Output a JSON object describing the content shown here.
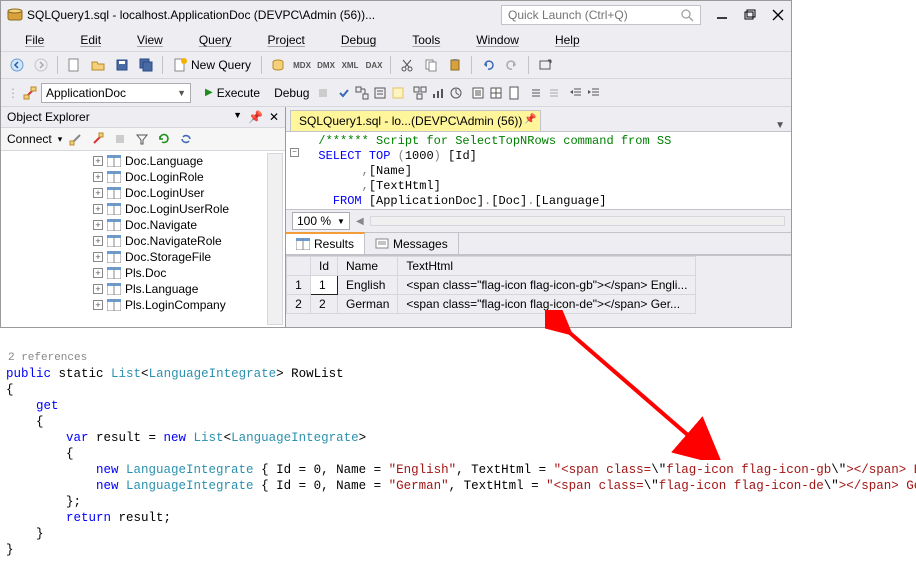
{
  "window": {
    "title": "SQLQuery1.sql - localhost.ApplicationDoc (DEVPC\\Admin (56))...",
    "quick_launch": {
      "placeholder": "Quick Launch (Ctrl+Q)"
    }
  },
  "menu": {
    "file": "File",
    "edit": "Edit",
    "view": "View",
    "query": "Query",
    "project": "Project",
    "debug": "Debug",
    "tools": "Tools",
    "window": "Window",
    "help": "Help"
  },
  "toolbar": {
    "new_query": "New Query"
  },
  "toolbar2": {
    "database": "ApplicationDoc",
    "execute": "Execute",
    "debug": "Debug"
  },
  "object_explorer": {
    "title": "Object Explorer",
    "connect": "Connect",
    "items": [
      "Doc.Language",
      "Doc.LoginRole",
      "Doc.LoginUser",
      "Doc.LoginUserRole",
      "Doc.Navigate",
      "Doc.NavigateRole",
      "Doc.StorageFile",
      "Pls.Doc",
      "Pls.Language",
      "Pls.LoginCompany"
    ]
  },
  "editor": {
    "tab": "SQLQuery1.sql - lo...(DEVPC\\Admin (56))",
    "l1": "/****** Script for SelectTopNRows command from SS",
    "l2a": "SELECT",
    "l2b": " TOP ",
    "l2c": "(",
    "l2d": "1000",
    "l2e": ")",
    "l2f": " [Id]",
    "l3a": ",",
    "l3b": "[Name]",
    "l4a": ",",
    "l4b": "[TextHtml]",
    "l5a": "FROM",
    "l5b": " [ApplicationDoc]",
    "l5c": ".",
    "l5d": "[Doc]",
    "l5e": ".",
    "l5f": "[Language]",
    "zoom": "100 %"
  },
  "results": {
    "tab_results": "Results",
    "tab_messages": "Messages",
    "headers": {
      "row": "",
      "id": "Id",
      "name": "Name",
      "texthtml": "TextHtml"
    },
    "rows": [
      {
        "n": "1",
        "id": "1",
        "name": "English",
        "text": "<span class=\"flag-icon flag-icon-gb\"></span> Engli..."
      },
      {
        "n": "2",
        "id": "2",
        "name": "German",
        "text": "<span class=\"flag-icon flag-icon-de\"></span> Ger..."
      }
    ]
  },
  "code": {
    "refs": "2 references",
    "l1a": "public",
    "l1b": " static ",
    "l1c": "List",
    "l1d": "LanguageIntegrate",
    "l1e": "> RowList",
    "l2": "{",
    "l3": "    get",
    "l4": "    {",
    "l5a": "        var",
    "l5b": " result = ",
    "l5c": "new ",
    "l5d": "List",
    "l5e": "LanguageIntegrate",
    "l5f": ">",
    "l6": "        {",
    "l7a": "            new ",
    "l7b": "LanguageIntegrate",
    "l7c": " { Id = ",
    "l7d": "0",
    "l7e": ", Name = ",
    "l7f": "\"English\"",
    "l7g": ", TextHtml = ",
    "l7h": "\"<span class=",
    "l7i": "\\\"",
    "l7j": "flag-icon flag-icon-gb",
    "l7k": "\\\"",
    "l7l": "></span> English\"",
    "l7m": ",",
    "l8a": "            new ",
    "l8b": "LanguageIntegrate",
    "l8c": " { Id = ",
    "l8d": "0",
    "l8e": ", Name = ",
    "l8f": "\"German\"",
    "l8g": ", TextHtml = ",
    "l8h": "\"<span class=",
    "l8i": "\\\"",
    "l8j": "flag-icon flag-icon-de",
    "l8k": "\\\"",
    "l8l": "></span> German\"",
    "l8m": ",",
    "l9": "        };",
    "l10a": "        return",
    "l10b": " result;",
    "l11": "    }",
    "l12": "}"
  }
}
